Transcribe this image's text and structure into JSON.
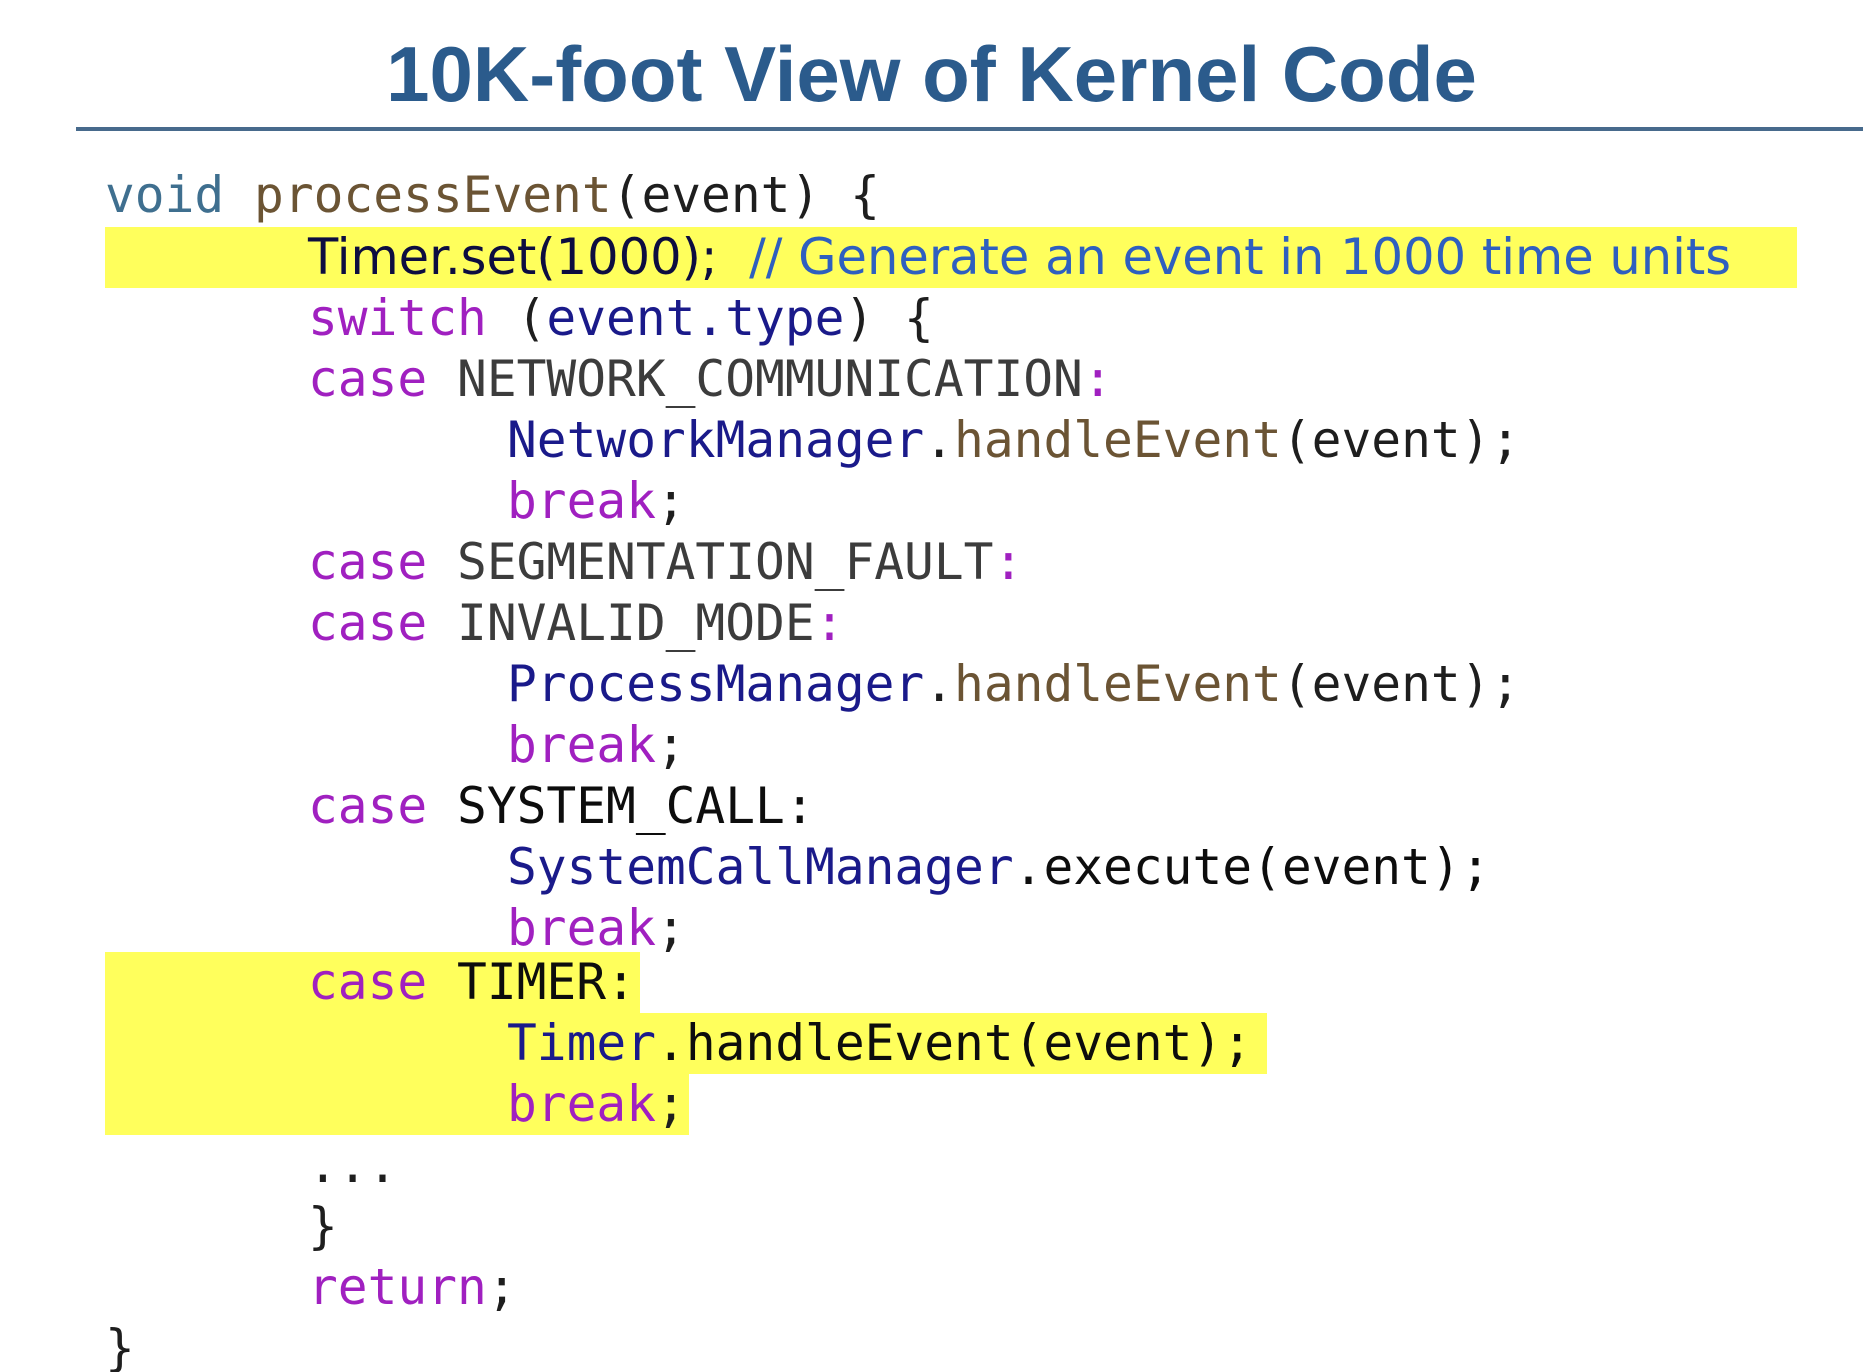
{
  "slide": {
    "title": "10K-foot View of Kernel Code"
  },
  "colors": {
    "title": "#2b5b8c",
    "rule": "#476a8c",
    "highlight": "#ffff5c",
    "keyword_void": "#3f6f8f",
    "keyword": "#a020c0",
    "function": "#6b5434",
    "class_name": "#1a1a8a",
    "comment": "#2e5fbf",
    "constant": "#3c3c3c",
    "default": "#1e1e1e"
  },
  "code": {
    "line1": {
      "kw": "void",
      "sp": " ",
      "fn": "processEvent",
      "rest": "(event) {"
    },
    "line2": {
      "call": "Timer.set(1000);",
      "gap": "  ",
      "comment": "// Generate an event in 1000 time units"
    },
    "line3": {
      "kw": "switch",
      "rest_a": " (",
      "expr": "event.type",
      "rest_b": ") {"
    },
    "line4": {
      "kw": "case",
      "label": " NETWORK_COMMUNICATION",
      "colon": ":"
    },
    "line5": {
      "cls": "NetworkManager",
      "dot": ".",
      "fn": "handleEvent",
      "rest": "(event);"
    },
    "line6": {
      "kw": "break",
      "semi": ";"
    },
    "line7": {
      "kw": "case",
      "label": " SEGMENTATION_FAULT",
      "colon": ":"
    },
    "line8": {
      "kw": "case",
      "label": " INVALID_MODE",
      "colon": ":"
    },
    "line9": {
      "cls": "ProcessManager",
      "dot": ".",
      "fn": "handleEvent",
      "rest": "(event);"
    },
    "line10": {
      "kw": "break",
      "semi": ";"
    },
    "line11": {
      "kw": "case",
      "label": " SYSTEM_CALL:"
    },
    "line12": {
      "cls": "SystemCallManager",
      "rest": ".execute(event);"
    },
    "line13": {
      "kw": "break",
      "semi": ";"
    },
    "line14": {
      "kw": "case",
      "label": " TIMER:"
    },
    "line15": {
      "cls": "Timer",
      "rest": ".handleEvent(event);"
    },
    "line16": {
      "kw": "break",
      "semi": ";"
    },
    "line17": {
      "text": "..."
    },
    "line18": {
      "text": "}"
    },
    "line19": {
      "kw": "return",
      "semi": ";"
    },
    "line20": {
      "text": "}"
    }
  }
}
